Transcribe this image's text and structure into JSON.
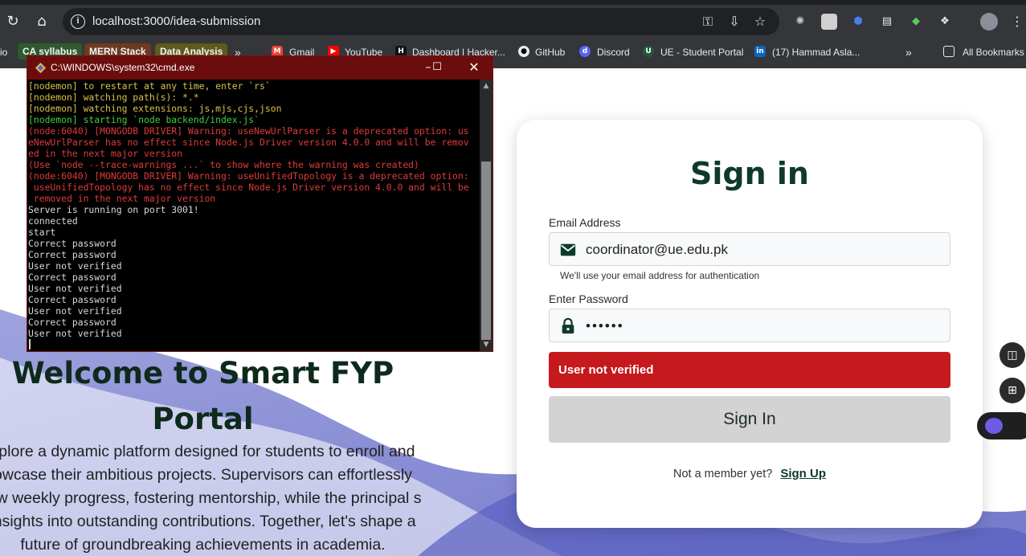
{
  "browser": {
    "url": "localhost:3000/idea-submission",
    "bookmarks": [
      {
        "label": "io"
      },
      {
        "label": "CA syllabus",
        "color": "#2e6b2e"
      },
      {
        "label": "MERN Stack",
        "color": "#7a3a1a"
      },
      {
        "label": "Data Analysis",
        "color": "#6b6420"
      },
      {
        "label": "Gmail"
      },
      {
        "label": "YouTube"
      },
      {
        "label": "Dashboard | Hacker..."
      },
      {
        "label": "GitHub"
      },
      {
        "label": "Discord"
      },
      {
        "label": "UE - Student Portal"
      },
      {
        "label": "(17) Hammad Asla..."
      }
    ],
    "all_bookmarks": "All Bookmarks",
    "more_bookmarks": "»"
  },
  "cmd": {
    "title": "C:\\WINDOWS\\system32\\cmd.exe",
    "lines": [
      {
        "text": "[nodemon] to restart at any time, enter `rs`",
        "color": "y"
      },
      {
        "text": "[nodemon] watching path(s): *.*",
        "color": "y"
      },
      {
        "text": "[nodemon] watching extensions: js,mjs,cjs,json",
        "color": "y"
      },
      {
        "text": "[nodemon] starting `node backend/index.js`",
        "color": "g"
      },
      {
        "text": "(node:6040) [MONGODB DRIVER] Warning: useNewUrlParser is a deprecated option: us",
        "color": "r"
      },
      {
        "text": "eNewUrlParser has no effect since Node.js Driver version 4.0.0 and will be remov",
        "color": "r"
      },
      {
        "text": "ed in the next major version",
        "color": "r"
      },
      {
        "text": "(Use `node --trace-warnings ...` to show where the warning was created)",
        "color": "r"
      },
      {
        "text": "(node:6040) [MONGODB DRIVER] Warning: useUnifiedTopology is a deprecated option:",
        "color": "r"
      },
      {
        "text": " useUnifiedTopology has no effect since Node.js Driver version 4.0.0 and will be",
        "color": "r"
      },
      {
        "text": " removed in the next major version",
        "color": "r"
      },
      {
        "text": "Server is running on port 3001!",
        "color": "w"
      },
      {
        "text": "connected",
        "color": "w"
      },
      {
        "text": "start",
        "color": "w"
      },
      {
        "text": "Correct password",
        "color": "w"
      },
      {
        "text": "Correct password",
        "color": "w"
      },
      {
        "text": "User not verified",
        "color": "w"
      },
      {
        "text": "Correct password",
        "color": "w"
      },
      {
        "text": "User not verified",
        "color": "w"
      },
      {
        "text": "Correct password",
        "color": "w"
      },
      {
        "text": "User not verified",
        "color": "w"
      },
      {
        "text": "Correct password",
        "color": "w"
      },
      {
        "text": "User not verified",
        "color": "w"
      }
    ]
  },
  "hero": {
    "title": "Welcome to Smart FYP Portal",
    "description": "xplore a dynamic platform designed for students to enroll and owcase their ambitious projects. Supervisors can effortlessly iew weekly progress, fostering mentorship, while the principal s insights into outstanding contributions. Together, let's shape a future of groundbreaking achievements in academia."
  },
  "signin": {
    "title": "Sign in",
    "email_label": "Email Address",
    "email_value": "coordinator@ue.edu.pk",
    "email_helper": "We'll use your email address for authentication",
    "password_label": "Enter Password",
    "password_value": "••••••",
    "error": "User not verified",
    "button": "Sign In",
    "footer_text": "Not a member yet?",
    "signup_link": "Sign Up"
  },
  "colors": {
    "brand_dark_green": "#0e3a2a",
    "error_red": "#c5191d",
    "wave_blue": "#6c72c8"
  }
}
